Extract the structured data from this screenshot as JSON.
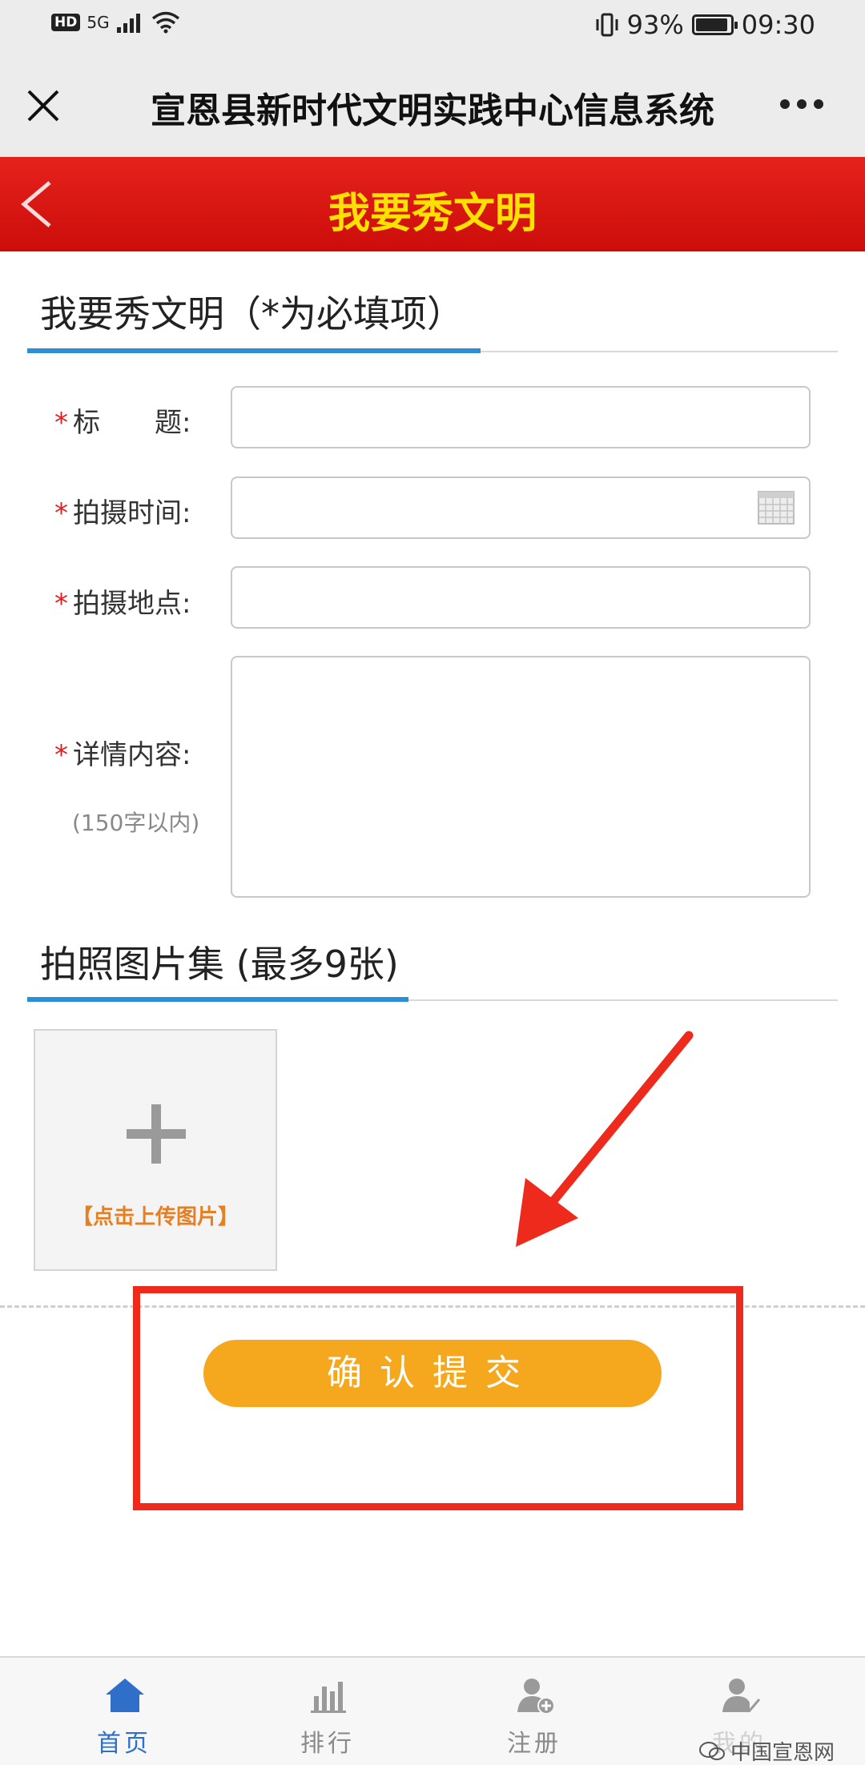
{
  "status_bar": {
    "hd": "HD",
    "network": "5G",
    "battery_pct": "93%",
    "battery_level": 0.93,
    "time": "09:30"
  },
  "titlebar": {
    "title": "宣恩县新时代文明实践中心信息系统"
  },
  "header": {
    "title": "我要秀文明"
  },
  "section1": {
    "title": "我要秀文明（*为必填项）"
  },
  "form": {
    "required_mark": "*",
    "title_label": "标　　题:",
    "time_label": "拍摄时间:",
    "place_label": "拍摄地点:",
    "detail_label": "详情内容:",
    "detail_hint": "(150字以内)"
  },
  "section2": {
    "title": "拍照图片集 (最多9张)"
  },
  "upload": {
    "label": "【点击上传图片】"
  },
  "submit": {
    "label": "确认提交"
  },
  "tabs": [
    {
      "label": "首页",
      "icon": "home-icon",
      "active": true
    },
    {
      "label": "排行",
      "icon": "ranking-icon",
      "active": false
    },
    {
      "label": "注册",
      "icon": "register-icon",
      "active": false
    },
    {
      "label": "我的",
      "icon": "user-check-icon",
      "active": false
    }
  ],
  "watermark": {
    "text": "中国宣恩网"
  },
  "colors": {
    "accent_red": "#e6221c",
    "title_yellow": "#ffe000",
    "submit_orange": "#f5a81d",
    "underline_blue": "#2a8fd6",
    "tab_active": "#2f6fc9",
    "annotation_red": "#ee2a1c"
  }
}
